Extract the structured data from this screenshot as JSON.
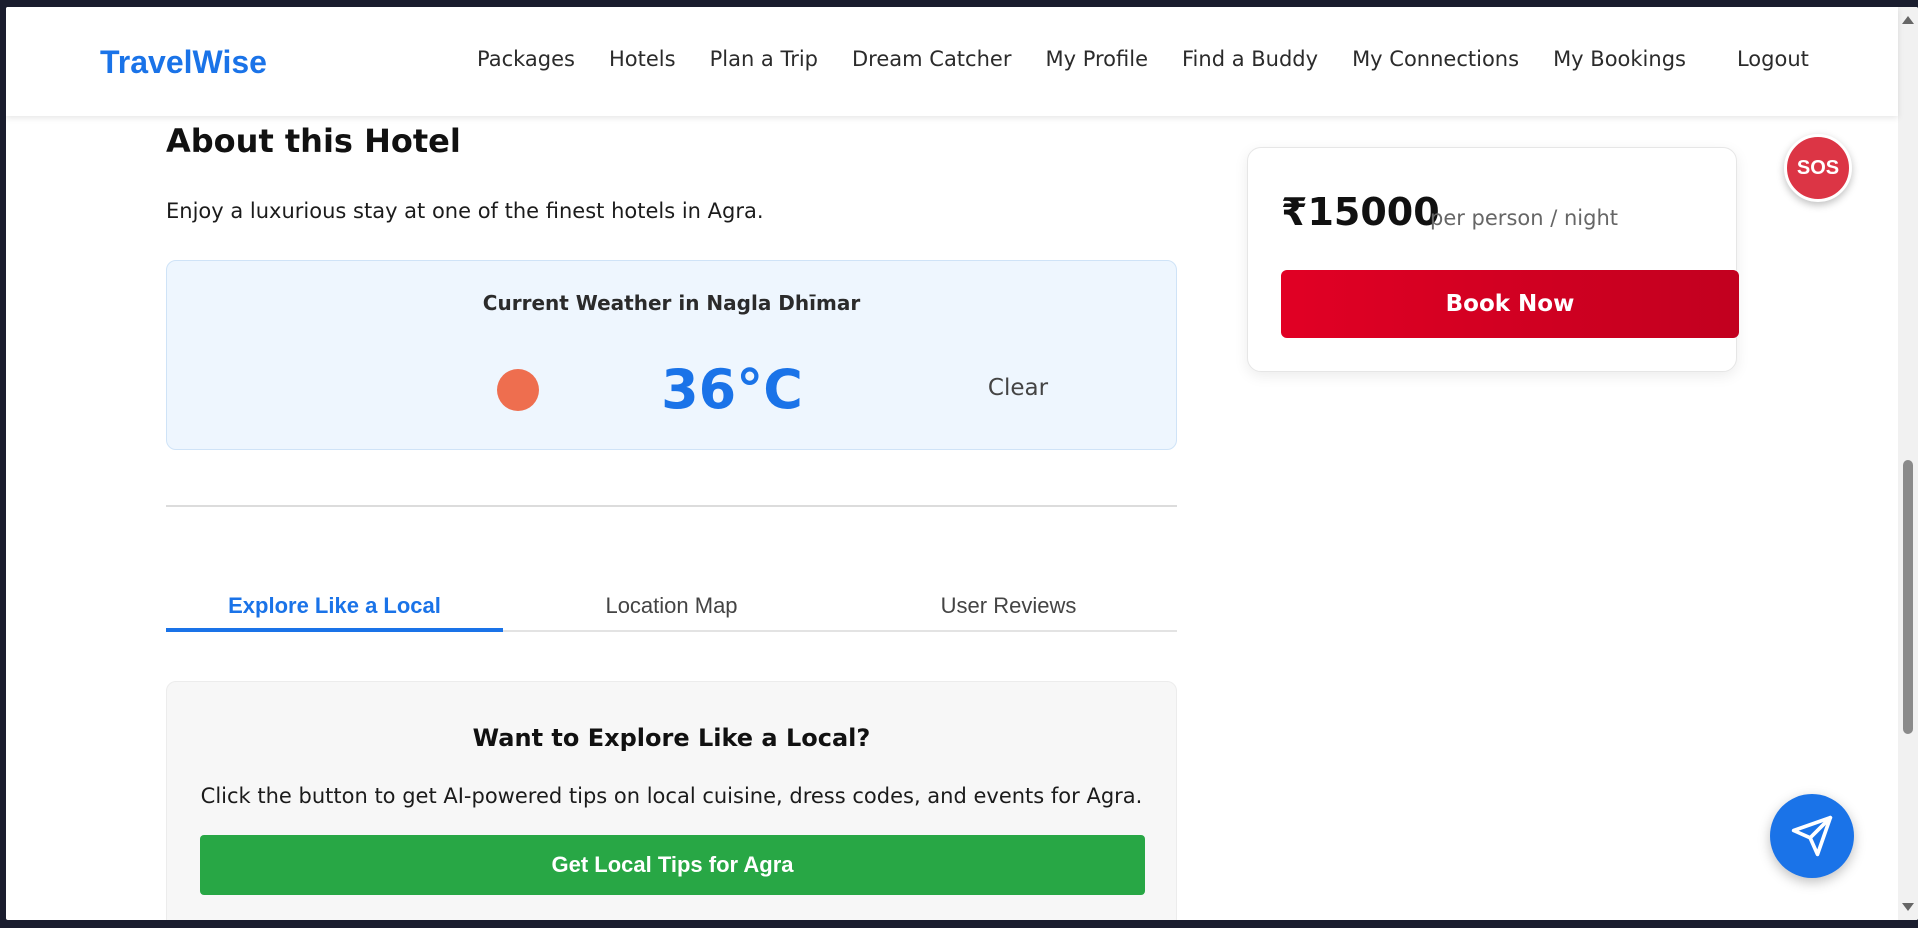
{
  "navbar": {
    "brand": "TravelWise",
    "links": [
      "Packages",
      "Hotels",
      "Plan a Trip",
      "Dream Catcher",
      "My Profile",
      "Find a Buddy",
      "My Connections",
      "My Bookings"
    ],
    "logout": "Logout"
  },
  "about": {
    "title": "About this Hotel",
    "description": "Enjoy a luxurious stay at one of the finest hotels in Agra."
  },
  "weather": {
    "title": "Current Weather in Nagla Dhīmar",
    "icon": "sun-icon",
    "icon_color": "#ee6e4f",
    "temperature": "36°C",
    "condition": "Clear"
  },
  "tabs": {
    "items": [
      "Explore Like a Local",
      "Location Map",
      "User Reviews"
    ],
    "active_index": 0
  },
  "explore": {
    "title": "Want to Explore Like a Local?",
    "description": "Click the button to get AI-powered tips on local cuisine, dress codes, and events for Agra.",
    "button_label": "Get Local Tips for Agra"
  },
  "booking": {
    "price": "₹15000",
    "unit": "per person / night",
    "button_label": "Book Now"
  },
  "floating": {
    "sos_label": "SOS",
    "send_icon": "paper-plane-icon"
  },
  "colors": {
    "brand": "#1a73e8",
    "book_button": "#e10024",
    "tips_button": "#28a745",
    "sos": "#dc3545"
  }
}
